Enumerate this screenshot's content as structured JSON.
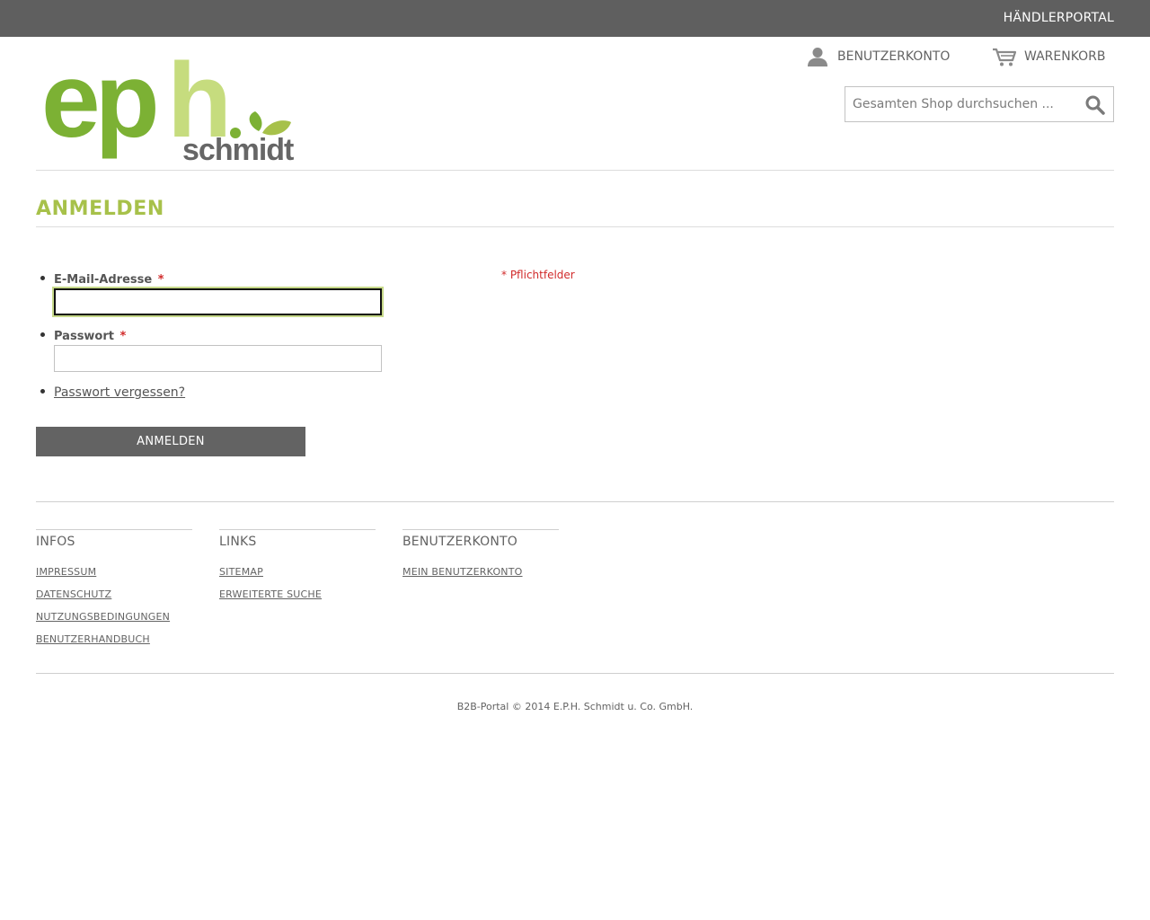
{
  "topbar": {
    "portal_label": "HÄNDLERPORTAL"
  },
  "header": {
    "logo": {
      "primary_text": "eph",
      "secondary_text": "schmidt"
    },
    "account_label": "BENUTZERKONTO",
    "cart_label": "WARENKORB",
    "search": {
      "placeholder": "Gesamten Shop durchsuchen ..."
    }
  },
  "page": {
    "title": "ANMELDEN"
  },
  "form": {
    "email_label": "E-Mail-Adresse",
    "password_label": "Passwort",
    "required_marker": "*",
    "email_value": "",
    "password_value": "",
    "forgot_label": "Passwort vergessen?",
    "required_note": "* Pflichtfelder",
    "submit_label": "ANMELDEN"
  },
  "footer": {
    "columns": [
      {
        "title": "INFOS",
        "links": [
          "IMPRESSUM",
          "DATENSCHUTZ",
          "NUTZUNGSBEDINGUNGEN",
          "BENUTZERHANDBUCH"
        ]
      },
      {
        "title": "LINKS",
        "links": [
          "SITEMAP",
          "ERWEITERTE SUCHE"
        ]
      },
      {
        "title": "BENUTZERKONTO",
        "links": [
          "MEIN BENUTZERKONTO"
        ]
      }
    ],
    "copyright": "B2B-Portal © 2014 E.P.H. Schmidt u. Co. GmbH."
  },
  "colors": {
    "topbar": "#5f5f5f",
    "accent_green": "#a7c14a",
    "logo_dark_green": "#7cb134",
    "logo_light_green": "#c6dc7e",
    "logo_gray": "#666666",
    "required_red": "#d12b2b",
    "button": "#636363"
  },
  "icons": [
    "user-icon",
    "cart-icon",
    "search-icon"
  ]
}
